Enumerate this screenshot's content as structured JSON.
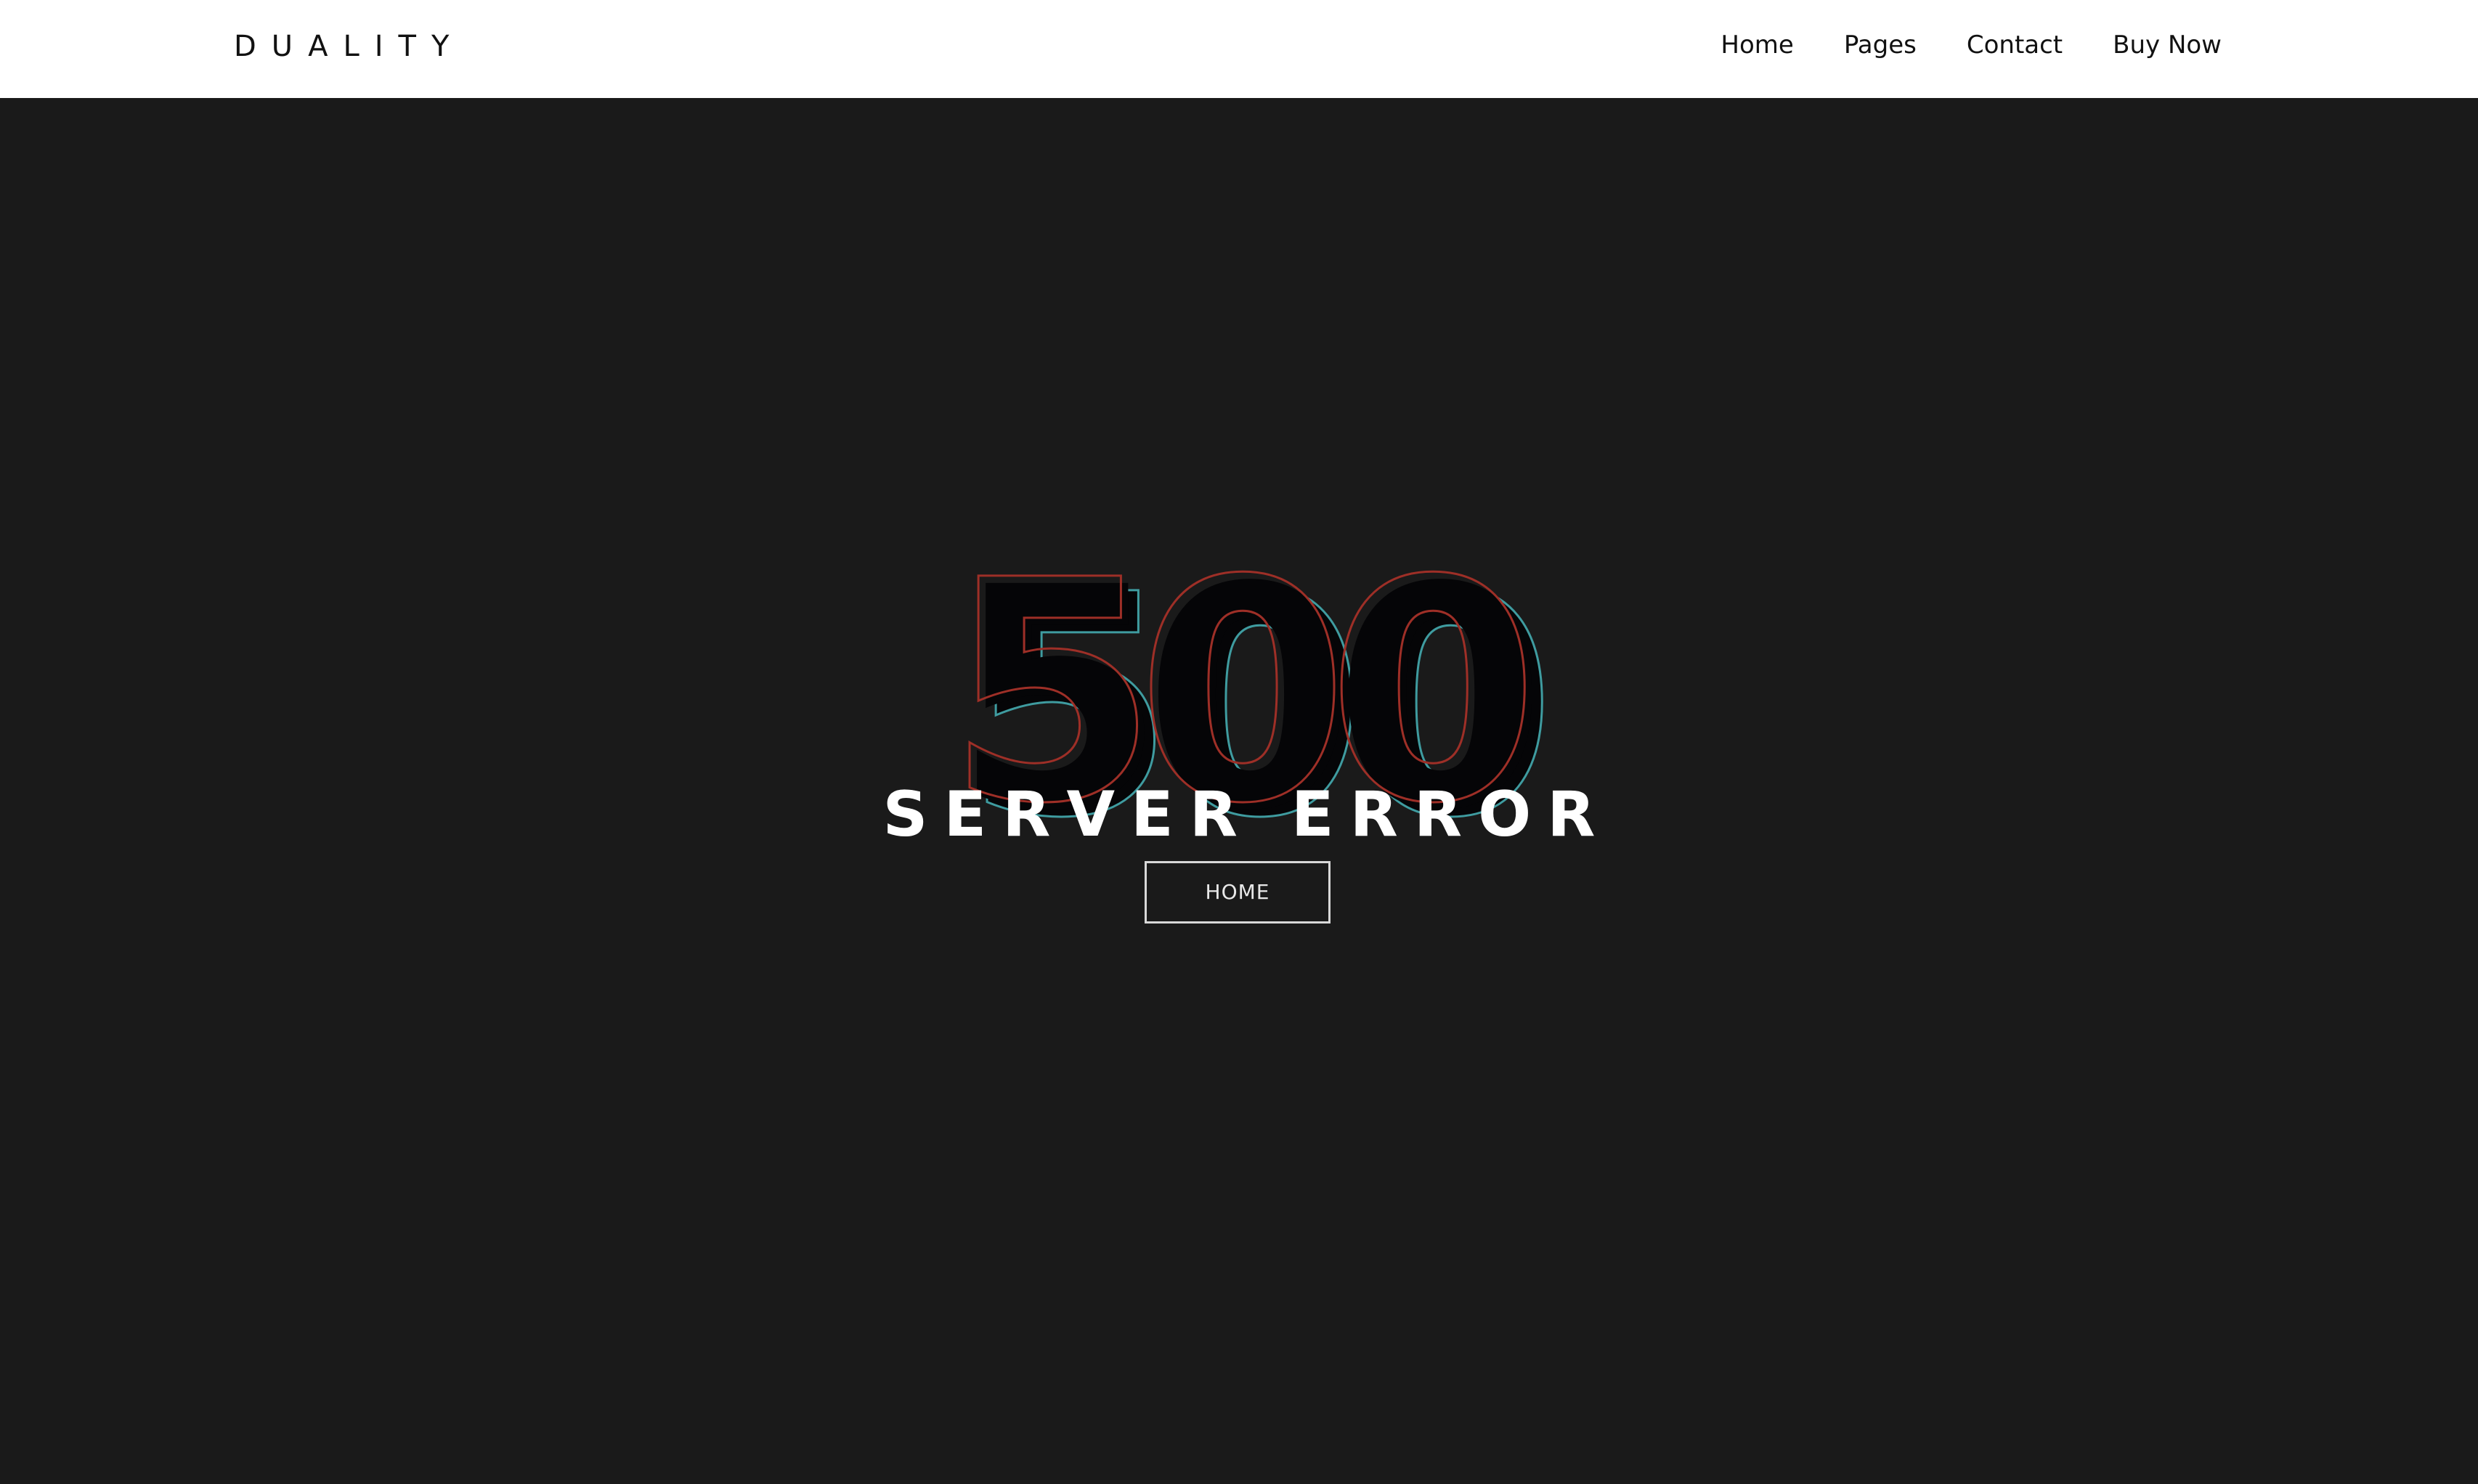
{
  "header": {
    "brand": "DUALITY",
    "nav": [
      {
        "label": "Home"
      },
      {
        "label": "Pages"
      },
      {
        "label": "Contact"
      },
      {
        "label": "Buy Now"
      }
    ]
  },
  "error": {
    "code": "500",
    "title": "SERVER ERROR",
    "button_label": "HOME"
  },
  "colors": {
    "header_bg": "#ffffff",
    "page_bg": "#1a1a1a",
    "code_fill": "#050507",
    "outline_red": "#9e2f27",
    "outline_teal": "#3f9ca0",
    "text_light": "#ffffff"
  }
}
